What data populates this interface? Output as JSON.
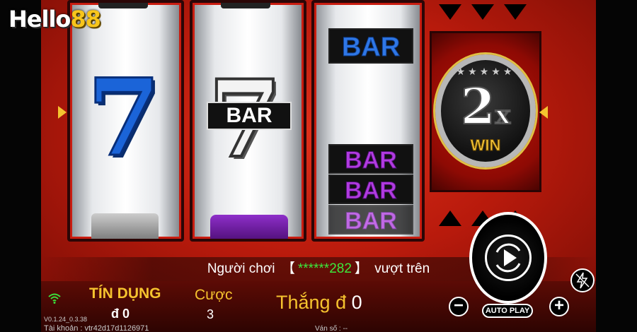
{
  "logo": {
    "part1": "Hello",
    "part2": "88"
  },
  "reels": {
    "reel1": {
      "symbol": "7"
    },
    "reel2": {
      "symbol": "7",
      "overlay": "BAR"
    },
    "reel3": {
      "top": "BAR",
      "stack": [
        "BAR",
        "BAR",
        "BAR"
      ]
    }
  },
  "multiplier": {
    "value": "2",
    "suffix": "x",
    "label": "WIN"
  },
  "notice": {
    "prefix": "Người chơi",
    "bracket_open": "【",
    "player": "******282",
    "bracket_close": "】",
    "suffix": "vượt trên"
  },
  "status": {
    "version": "V0.1.24_0.3.38",
    "account_label": "Tài khoản : vtr42d17d1126971",
    "credit_label": "TÍN DỤNG",
    "credit_value": "đ 0",
    "bet_label": "Cược",
    "bet_value": "3",
    "win_label": "Thắng",
    "win_currency": "đ",
    "win_value": "0",
    "round_label": "Ván số : --"
  },
  "controls": {
    "minus": "−",
    "plus": "+",
    "autoplay": "AUTO PLAY"
  },
  "icons": [
    "wifi-icon",
    "spin-icon",
    "turbo-icon",
    "payline-arrow-icon"
  ],
  "colors": {
    "accent_gold": "#f5c22e",
    "background_red": "#c91c10",
    "player_green": "#3ce83c"
  }
}
